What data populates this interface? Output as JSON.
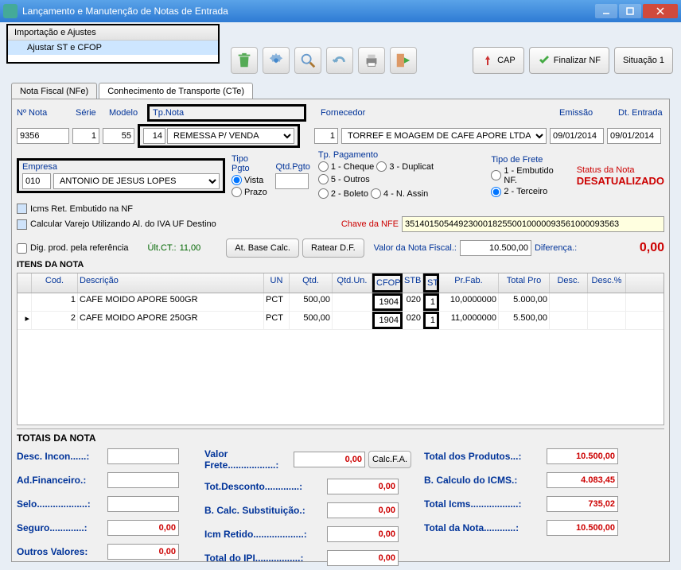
{
  "window": {
    "title": "Lançamento e Manutenção de Notas de Entrada"
  },
  "menu": {
    "import": "Importação e Ajustes",
    "adjust": "Ajustar ST e CFOP"
  },
  "toolbar": {
    "cap": "CAP",
    "finalizar": "Finalizar NF",
    "situacao": "Situação 1"
  },
  "tabs": {
    "nfe": "Nota Fiscal (NFe)",
    "cte": "Conhecimento de Transporte (CTe)"
  },
  "fields": {
    "numNota_lbl": "Nº Nota",
    "numNota": "9356",
    "serie_lbl": "Série",
    "serie": "1",
    "modelo_lbl": "Modelo",
    "modelo": "55",
    "tpnota_lbl": "Tp.Nota",
    "tpnota_code": "14",
    "tpnota_desc": "REMESSA P/  VENDA",
    "fornecedor_lbl": "Fornecedor",
    "fornecedor_code": "1",
    "fornecedor_desc": "TORREF E MOAGEM DE CAFE APORE LTDA",
    "emissao_lbl": "Emissão",
    "emissao": "09/01/2014",
    "dtentrada_lbl": "Dt. Entrada",
    "dtentrada": "09/01/2014",
    "empresa_lbl": "Empresa",
    "empresa_code": "010",
    "empresa_desc": "ANTONIO DE JESUS LOPES",
    "tipopgto_lbl": "Tipo Pgto",
    "vista": "Vista",
    "prazo": "Prazo",
    "qtdpgto_lbl": "Qtd.Pgto",
    "tppag_lbl": "Tp. Pagamento",
    "cheque": "1 - Cheque",
    "boleto": "2 - Boleto",
    "duplicat": "3 - Duplicat",
    "nassin": "4 - N. Assin",
    "outros": "5 - Outros",
    "tipofrete_lbl": "Tipo de Frete",
    "embutido": "1 - Embutido NF.",
    "terceiro": "2 - Terceiro",
    "status_lbl": "Status da Nota",
    "status": "DESATUALIZADO",
    "icms_ret": "Icms Ret. Embutido na NF",
    "calc_varejo": "Calcular Varejo Utilizando Al. do IVA UF Destino",
    "chave_lbl": "Chave da NFE",
    "chave": "35140150544923000182550010000093561000093563",
    "digprod": "Dig. prod. pela referência",
    "ultct_lbl": "Últ.CT.:",
    "ultct": "11,00",
    "atbase": "At. Base Calc.",
    "ratear": "Ratear D.F.",
    "valornota_lbl": "Valor da Nota Fiscal.:",
    "valornota": "10.500,00",
    "diferenca_lbl": "Diferença.:",
    "diferenca": "0,00"
  },
  "grid": {
    "title": "ITENS DA NOTA",
    "headers": {
      "cod": "Cod.",
      "desc": "Descrição",
      "un": "UN",
      "qtd": "Qtd.",
      "qtdun": "Qtd.Un.",
      "cfop": "CFOP",
      "stb": "STB",
      "st": "ST",
      "fab": "Pr.Fab.",
      "tot": "Total Pro",
      "dsc": "Desc.",
      "dscp": "Desc.%"
    },
    "rows": [
      {
        "cod": "1",
        "desc": "CAFE MOIDO APORE 500GR",
        "un": "PCT",
        "qtd": "500,00",
        "qtdun": "",
        "cfop": "1904",
        "stb": "020",
        "st": "1",
        "fab": "10,0000000",
        "tot": "5.000,00",
        "dsc": "",
        "dscp": ""
      },
      {
        "cod": "2",
        "desc": "CAFE MOIDO APORE 250GR",
        "un": "PCT",
        "qtd": "500,00",
        "qtdun": "",
        "cfop": "1904",
        "stb": "020",
        "st": "1",
        "fab": "11,0000000",
        "tot": "5.500,00",
        "dsc": "",
        "dscp": ""
      }
    ]
  },
  "totals": {
    "heading": "TOTAIS DA NOTA",
    "desc_incon": "Desc. Incon......:",
    "desc_incon_v": "",
    "ad_fin": "Ad.Financeiro.:",
    "ad_fin_v": "",
    "selo": "Selo...................:",
    "selo_v": "",
    "seguro": "Seguro.............:",
    "seguro_v": "0,00",
    "outros": "Outros Valores:",
    "outros_v": "0,00",
    "valor_frete": "Valor Frete..................:",
    "valor_frete_v": "0,00",
    "tot_desc": "Tot.Desconto.............:",
    "tot_desc_v": "0,00",
    "bcalc_sub": "B. Calc. Substituição.:",
    "bcalc_sub_v": "0,00",
    "icm_ret": "Icm Retido...................:",
    "icm_ret_v": "0,00",
    "tot_ipi": "Total do IPI.................:",
    "tot_ipi_v": "0,00",
    "calcfa": "Calc.F.A.",
    "tot_prod": "Total dos Produtos...:",
    "tot_prod_v": "10.500,00",
    "bcalc_icms": "B. Calculo do ICMS.:",
    "bcalc_icms_v": "4.083,45",
    "tot_icms": "Total Icms..................:",
    "tot_icms_v": "735,02",
    "tot_nota": "Total da Nota............:",
    "tot_nota_v": "10.500,00"
  }
}
